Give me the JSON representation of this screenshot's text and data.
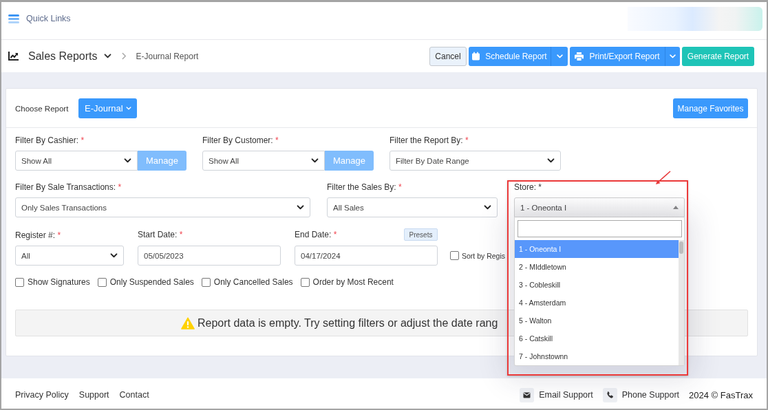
{
  "top_bar": {
    "menu_label": "Quick Links"
  },
  "page_header": {
    "section": "Sales Reports",
    "current_page": "E-Journal Report",
    "cancel_button": "Cancel",
    "schedule_button": "Schedule Report",
    "export_button": "Print/Export Report",
    "generate_button": "Generate Report"
  },
  "report_picker": {
    "label": "Choose Report",
    "value": "E-Journal",
    "favorites_button": "Manage Favorites"
  },
  "filter_rows": [
    {
      "fields": [
        {
          "kind": "select_manage",
          "label": "Filter By Cashier:",
          "required_mark": "*",
          "value": "Show All",
          "button": "Manage"
        },
        {
          "kind": "select_manage",
          "label": "Filter By Customer:",
          "required_mark": "*",
          "value": "Show All",
          "button": "Manage"
        },
        {
          "kind": "select",
          "label": "Filter the Report By:",
          "required_mark": "*",
          "value": "Filter By Date Range"
        }
      ]
    },
    {
      "fields": [
        {
          "kind": "select",
          "label": "Filter By Sale Transactions:",
          "required_mark": "*",
          "value": "Only Sales Transactions"
        },
        {
          "kind": "select",
          "label": "Filter the Sales By:",
          "required_mark": "*",
          "value": "All Sales"
        },
        {
          "kind": "combo",
          "label": "Store: *",
          "value": "1 - Oneonta I",
          "expanded": true,
          "options": [
            {
              "label": "1 - Oneonta I",
              "selected": true
            },
            {
              "label": "2 - MIddletown",
              "selected": false
            },
            {
              "label": "3 - Cobleskill",
              "selected": false
            },
            {
              "label": "4 - Amsterdam",
              "selected": false
            },
            {
              "label": "5 - Walton",
              "selected": false
            },
            {
              "label": "6 - Catskill",
              "selected": false
            },
            {
              "label": "7 - Johnstownn",
              "selected": false
            }
          ]
        }
      ]
    },
    {
      "fields": [
        {
          "kind": "select",
          "label": "Register #:",
          "required_mark": "*",
          "value": "All"
        },
        {
          "kind": "date",
          "label": "Start Date:",
          "required_mark": "*",
          "value": "05/05/2023"
        },
        {
          "kind": "date",
          "label": "End Date:",
          "required_mark": "*",
          "value": "04/17/2024",
          "button": "Presets"
        },
        {
          "kind": "checkbox",
          "label": "Sort by Regis",
          "checked": false
        }
      ]
    }
  ],
  "checkboxes": [
    {
      "label": "Show Signatures",
      "checked": false
    },
    {
      "label": "Only Suspended Sales",
      "checked": false
    },
    {
      "label": "Only Cancelled Sales",
      "checked": false
    },
    {
      "label": "Order by Most Recent",
      "checked": false
    }
  ],
  "alert": {
    "text": "Report data is empty. Try setting filters or adjust the date rang"
  },
  "footer": {
    "links": [
      "Privacy Policy",
      "Support",
      "Contact"
    ],
    "email_support": "Email Support",
    "phone_support": "Phone Support",
    "copyright": "2024 © FasTrax"
  }
}
